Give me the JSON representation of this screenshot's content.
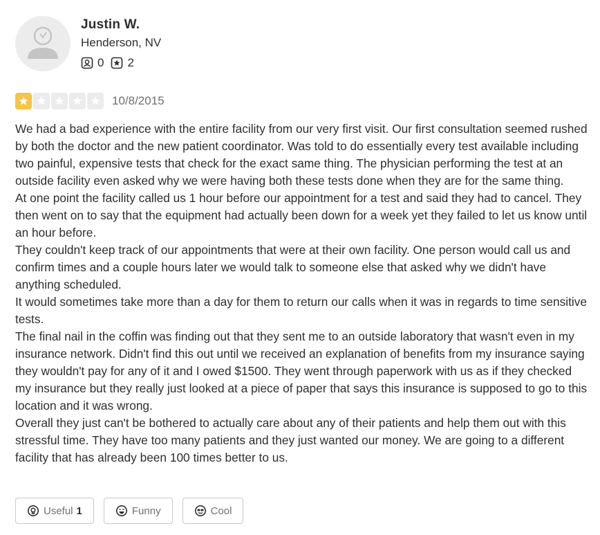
{
  "reviewer": {
    "name": "Justin W.",
    "location": "Henderson, NV",
    "friends_count": "0",
    "reviews_count": "2"
  },
  "review": {
    "rating": 1,
    "max_rating": 5,
    "star_color": "#f7c443",
    "date": "10/8/2015",
    "paragraphs": [
      "We had a bad experience with the entire facility from our very first visit. Our first consultation seemed rushed by both the doctor and the new patient coordinator. Was told to do essentially every test available including two painful, expensive tests that check for the exact same thing. The physician performing the test at an outside facility even asked why we were having both these tests done when they are for the same thing.",
      "At one point the facility called us 1 hour before our appointment for a test and said they had to cancel. They then went on to say that the equipment had actually been down for a week yet they failed to let us know until an hour before.",
      "They couldn't keep track of our appointments that were at their own facility. One person would call us and confirm times and a couple hours later we would talk to someone else that asked why we didn't have anything scheduled.",
      "It would sometimes take more than a day for them to return our calls when it was in regards to time sensitive tests.",
      "The final nail in the coffin was finding out that they sent me to an outside laboratory that wasn't even in my insurance network. Didn't find this out until we received an explanation of benefits from my insurance saying they wouldn't pay for any of it and I owed $1500. They went through paperwork with us as if they checked my insurance but they really just looked at a piece of paper that says this insurance is supposed to go to this location and it was wrong.",
      "Overall they just can't be bothered to actually care about any of their patients and help them out with this stressful time. They have too many patients and they just wanted our money. We are going to a different facility that has already been 100 times better to us."
    ]
  },
  "reactions": {
    "useful_label": "Useful",
    "useful_count": "1",
    "funny_label": "Funny",
    "cool_label": "Cool"
  }
}
